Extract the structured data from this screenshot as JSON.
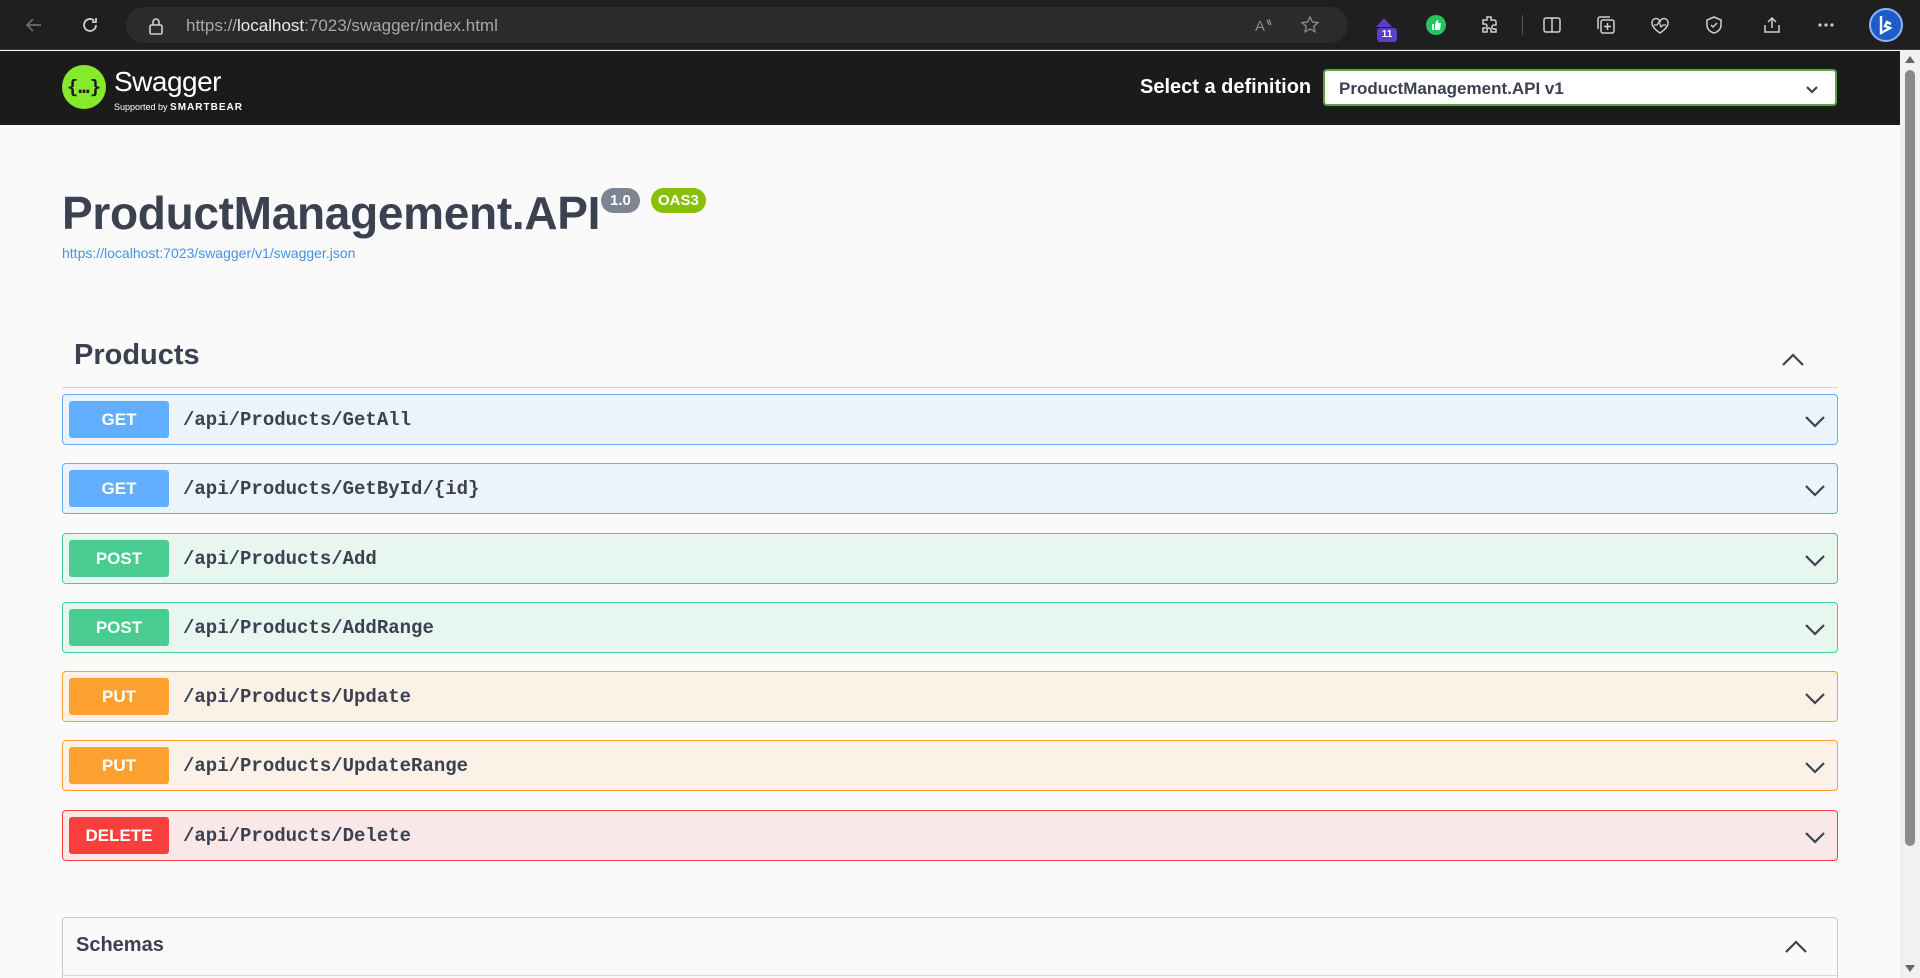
{
  "browser": {
    "url_scheme": "https://",
    "url_host": "localhost",
    "url_rest": ":7023/swagger/index.html",
    "extension_badge": "11"
  },
  "topbar": {
    "logo_text": "Swagger",
    "logo_sub_prefix": "Supported by ",
    "logo_sub_brand": "SMARTBEAR",
    "definition_label": "Select a definition",
    "definition_value": "ProductManagement.API v1"
  },
  "info": {
    "title": "ProductManagement.API",
    "version": "1.0",
    "oas": "OAS3",
    "spec_url": "https://localhost:7023/swagger/v1/swagger.json"
  },
  "tag": {
    "name": "Products",
    "operations": [
      {
        "method": "GET",
        "path": "/api/Products/GetAll"
      },
      {
        "method": "GET",
        "path": "/api/Products/GetById/{id}"
      },
      {
        "method": "POST",
        "path": "/api/Products/Add"
      },
      {
        "method": "POST",
        "path": "/api/Products/AddRange"
      },
      {
        "method": "PUT",
        "path": "/api/Products/Update"
      },
      {
        "method": "PUT",
        "path": "/api/Products/UpdateRange"
      },
      {
        "method": "DELETE",
        "path": "/api/Products/Delete"
      }
    ]
  },
  "schemas": {
    "title": "Schemas"
  },
  "colors": {
    "get": "#61affe",
    "post": "#49cc90",
    "put": "#fca130",
    "delete": "#f93e3e",
    "swagger_green": "#85ea2d"
  }
}
